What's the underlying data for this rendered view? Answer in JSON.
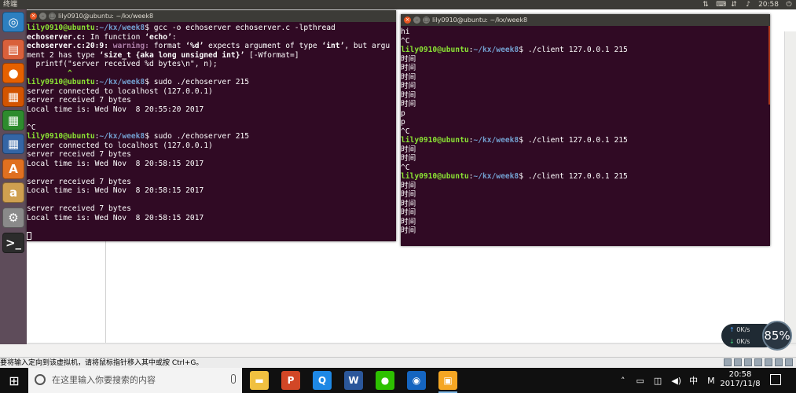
{
  "topbar": {
    "title": "终端",
    "clock": "20:58",
    "icons": [
      "sort-icon",
      "keyboard-icon",
      "network-icon",
      "volume-icon",
      "power-icon"
    ]
  },
  "launcher": {
    "items": [
      {
        "name": "ubuntu-dash",
        "glyph": "◎",
        "color": "#2d7fc0"
      },
      {
        "name": "files",
        "glyph": "▤",
        "color": "#d9603b"
      },
      {
        "name": "firefox",
        "glyph": "●",
        "color": "#e66000"
      },
      {
        "name": "libreoffice-writer",
        "glyph": "▦",
        "color": "#d35400"
      },
      {
        "name": "libreoffice-calc",
        "glyph": "▦",
        "color": "#2e8b2e"
      },
      {
        "name": "libreoffice-impress",
        "glyph": "▦",
        "color": "#3465a4"
      },
      {
        "name": "software-center",
        "glyph": "A",
        "color": "#e07020"
      },
      {
        "name": "amazon",
        "glyph": "a",
        "color": "#cfa050"
      },
      {
        "name": "system-settings",
        "glyph": "⚙",
        "color": "#8a8a8a"
      },
      {
        "name": "terminal",
        "glyph": ">_",
        "color": "#2c2c2c"
      }
    ]
  },
  "term_left": {
    "title": "lily0910@ubuntu: ~/kx/week8",
    "lines": [
      [
        {
          "t": "lily0910@ubuntu",
          "c": "g"
        },
        {
          "t": ":",
          "c": ""
        },
        {
          "t": "~/kx/week8",
          "c": "b"
        },
        {
          "t": "$ gcc -o echoserver echoserver.c -lpthread",
          "c": ""
        }
      ],
      [
        {
          "t": "echoserver.c:",
          "c": "w"
        },
        {
          "t": " In function ",
          "c": ""
        },
        {
          "t": "‘echo’",
          "c": "w"
        },
        {
          "t": ":",
          "c": ""
        }
      ],
      [
        {
          "t": "echoserver.c:20:9:",
          "c": "w"
        },
        {
          "t": " warning:",
          "c": "m"
        },
        {
          "t": " format ",
          "c": ""
        },
        {
          "t": "‘%d’",
          "c": "w"
        },
        {
          "t": " expects argument of type ",
          "c": ""
        },
        {
          "t": "‘int’",
          "c": "w"
        },
        {
          "t": ", but argu",
          "c": ""
        }
      ],
      [
        {
          "t": "ment 2 has type ",
          "c": ""
        },
        {
          "t": "‘size_t {aka long unsigned int}’",
          "c": "w"
        },
        {
          "t": " [-Wformat=]",
          "c": ""
        }
      ],
      [
        {
          "t": "  printf(\"server received %d bytes\\n\", n);",
          "c": ""
        }
      ],
      [
        {
          "t": "         ^",
          "c": "g"
        }
      ],
      [
        {
          "t": "lily0910@ubuntu",
          "c": "g"
        },
        {
          "t": ":",
          "c": ""
        },
        {
          "t": "~/kx/week8",
          "c": "b"
        },
        {
          "t": "$ sudo ./echoserver 215",
          "c": ""
        }
      ],
      [
        {
          "t": "server connected to localhost (127.0.0.1)",
          "c": ""
        }
      ],
      [
        {
          "t": "server received 7 bytes",
          "c": ""
        }
      ],
      [
        {
          "t": "Local time is: Wed Nov  8 20:55:20 2017",
          "c": ""
        }
      ],
      [
        {
          "t": "",
          "c": ""
        }
      ],
      [
        {
          "t": "^C",
          "c": ""
        }
      ],
      [
        {
          "t": "lily0910@ubuntu",
          "c": "g"
        },
        {
          "t": ":",
          "c": ""
        },
        {
          "t": "~/kx/week8",
          "c": "b"
        },
        {
          "t": "$ sudo ./echoserver 215",
          "c": ""
        }
      ],
      [
        {
          "t": "server connected to localhost (127.0.0.1)",
          "c": ""
        }
      ],
      [
        {
          "t": "server received 7 bytes",
          "c": ""
        }
      ],
      [
        {
          "t": "Local time is: Wed Nov  8 20:58:15 2017",
          "c": ""
        }
      ],
      [
        {
          "t": "",
          "c": ""
        }
      ],
      [
        {
          "t": "server received 7 bytes",
          "c": ""
        }
      ],
      [
        {
          "t": "Local time is: Wed Nov  8 20:58:15 2017",
          "c": ""
        }
      ],
      [
        {
          "t": "",
          "c": ""
        }
      ],
      [
        {
          "t": "server received 7 bytes",
          "c": ""
        }
      ],
      [
        {
          "t": "Local time is: Wed Nov  8 20:58:15 2017",
          "c": ""
        }
      ],
      [
        {
          "t": "",
          "c": ""
        }
      ],
      [
        {
          "t": "",
          "c": "cursor"
        }
      ]
    ]
  },
  "term_right": {
    "title": "lily0910@ubuntu: ~/kx/week8",
    "lines": [
      [
        {
          "t": "hi",
          "c": ""
        }
      ],
      [
        {
          "t": "^C",
          "c": ""
        }
      ],
      [
        {
          "t": "lily0910@ubuntu",
          "c": "g"
        },
        {
          "t": ":",
          "c": ""
        },
        {
          "t": "~/kx/week8",
          "c": "b"
        },
        {
          "t": "$ ./client 127.0.0.1 215",
          "c": ""
        }
      ],
      [
        {
          "t": "时间",
          "c": ""
        }
      ],
      [
        {
          "t": "时间",
          "c": ""
        }
      ],
      [
        {
          "t": "时间",
          "c": ""
        }
      ],
      [
        {
          "t": "时间",
          "c": ""
        }
      ],
      [
        {
          "t": "时间",
          "c": ""
        }
      ],
      [
        {
          "t": "时间",
          "c": ""
        }
      ],
      [
        {
          "t": "p",
          "c": ""
        }
      ],
      [
        {
          "t": "p",
          "c": ""
        }
      ],
      [
        {
          "t": "^C",
          "c": ""
        }
      ],
      [
        {
          "t": "lily0910@ubuntu",
          "c": "g"
        },
        {
          "t": ":",
          "c": ""
        },
        {
          "t": "~/kx/week8",
          "c": "b"
        },
        {
          "t": "$ ./client 127.0.0.1 215",
          "c": ""
        }
      ],
      [
        {
          "t": "时间",
          "c": ""
        }
      ],
      [
        {
          "t": "时间",
          "c": ""
        }
      ],
      [
        {
          "t": "^C",
          "c": ""
        }
      ],
      [
        {
          "t": "lily0910@ubuntu",
          "c": "g"
        },
        {
          "t": ":",
          "c": ""
        },
        {
          "t": "~/kx/week8",
          "c": "b"
        },
        {
          "t": "$ ./client 127.0.0.1 215",
          "c": ""
        }
      ],
      [
        {
          "t": "时间",
          "c": ""
        }
      ],
      [
        {
          "t": "时间",
          "c": ""
        }
      ],
      [
        {
          "t": "时间",
          "c": ""
        }
      ],
      [
        {
          "t": "时间",
          "c": ""
        }
      ],
      [
        {
          "t": "时间",
          "c": ""
        }
      ],
      [
        {
          "t": "时间",
          "c": ""
        }
      ]
    ]
  },
  "speed_widget": {
    "up": "0K/s",
    "down": "0K/s",
    "percent": "85%"
  },
  "vm_message": "要将输入定向到该虚拟机，请将鼠标指针移入其中或按 Ctrl+G。",
  "taskbar": {
    "search_placeholder": "在这里输入你要搜索的内容",
    "apps": [
      {
        "name": "file-explorer",
        "glyph": "▬",
        "color": "#f0c040"
      },
      {
        "name": "powerpoint",
        "glyph": "P",
        "color": "#d24726"
      },
      {
        "name": "qq-browser",
        "glyph": "Q",
        "color": "#1e88e5"
      },
      {
        "name": "word",
        "glyph": "W",
        "color": "#2b579a"
      },
      {
        "name": "wechat",
        "glyph": "●",
        "color": "#2dc100"
      },
      {
        "name": "browser",
        "glyph": "◉",
        "color": "#1565c0"
      },
      {
        "name": "vmware",
        "glyph": "▣",
        "color": "#f5a623"
      }
    ],
    "tray_lang": "中",
    "tray_ime": "M",
    "time": "20:58",
    "date": "2017/11/8"
  }
}
